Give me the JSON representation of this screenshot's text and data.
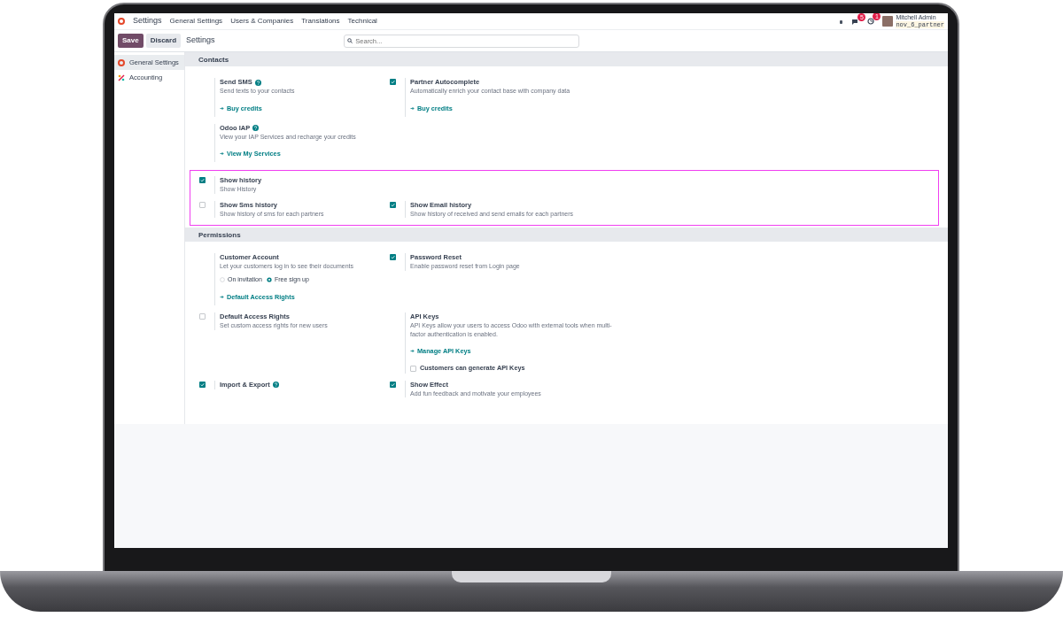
{
  "navbar": {
    "app_name": "Settings",
    "menu": [
      "General Settings",
      "Users & Companies",
      "Translations",
      "Technical"
    ],
    "systray": [
      {
        "kind": "debug"
      },
      {
        "kind": "chat",
        "badge": "5"
      },
      {
        "kind": "activity",
        "badge": "1"
      }
    ],
    "user": {
      "name": "Mitchell Admin",
      "database": "nov_6_partner"
    }
  },
  "control_panel": {
    "buttons": [
      {
        "label": "Save",
        "kind": "primary"
      },
      {
        "label": "Discard",
        "kind": "secondary"
      }
    ],
    "breadcrumb": "Settings",
    "search": {
      "placeholder": "Search..."
    }
  },
  "sidebar": {
    "items": [
      {
        "label": "General Settings",
        "kind": "settings",
        "selected": true
      },
      {
        "label": "Accounting",
        "kind": "accounting",
        "selected": false
      }
    ]
  },
  "sections": [
    {
      "title": "Contacts",
      "groups": [
        {
          "highlighted": false,
          "rows": [
            [
              {
                "kind": "plain",
                "title": "Send SMS",
                "help": true,
                "description": "Send texts to your contacts",
                "links": [
                  "Buy credits"
                ]
              },
              {
                "kind": "checkbox",
                "checked": true,
                "title": "Partner Autocomplete",
                "description": "Automatically enrich your contact base with company data",
                "links": [
                  "Buy credits"
                ]
              }
            ],
            [
              {
                "kind": "plain",
                "title": "Odoo IAP",
                "help": true,
                "description": "View your IAP Services and recharge your credits",
                "links": [
                  "View My Services"
                ]
              }
            ]
          ]
        },
        {
          "highlighted": true,
          "rows": [
            [
              {
                "kind": "checkbox",
                "checked": true,
                "title": "Show history",
                "description": "Show History"
              }
            ],
            [
              {
                "kind": "checkbox",
                "checked": false,
                "title": "Show Sms history",
                "description": "Show history of sms for each partners"
              },
              {
                "kind": "checkbox",
                "checked": true,
                "title": "Show Email history",
                "description": "Show history of received and send emails for each partners"
              }
            ]
          ]
        }
      ]
    },
    {
      "title": "Permissions",
      "groups": [
        {
          "highlighted": false,
          "rows": [
            [
              {
                "kind": "plain",
                "title": "Customer Account",
                "description": "Let your customers log in to see their documents",
                "radios": [
                  {
                    "label": "On invitation",
                    "selected": false
                  },
                  {
                    "label": "Free sign up",
                    "selected": true
                  }
                ],
                "links": [
                  "Default Access Rights"
                ]
              },
              {
                "kind": "checkbox",
                "checked": true,
                "title": "Password Reset",
                "description": "Enable password reset from Login page"
              }
            ],
            [
              {
                "kind": "checkbox",
                "checked": false,
                "title": "Default Access Rights",
                "description": "Set custom access rights for new users"
              },
              {
                "kind": "plain",
                "title": "API Keys",
                "description": "API Keys allow your users to access Odoo with external tools when multi-factor authentication is enabled.",
                "links": [
                  "Manage API Keys"
                ],
                "options": [
                  {
                    "label": "Customers can generate API Keys",
                    "checked": false
                  }
                ]
              }
            ],
            [
              {
                "kind": "checkbox",
                "checked": true,
                "title": "Import & Export",
                "help": true
              },
              {
                "kind": "checkbox",
                "checked": true,
                "title": "Show Effect",
                "description": "Add fun feedback and motivate your employees"
              }
            ]
          ]
        }
      ]
    }
  ]
}
